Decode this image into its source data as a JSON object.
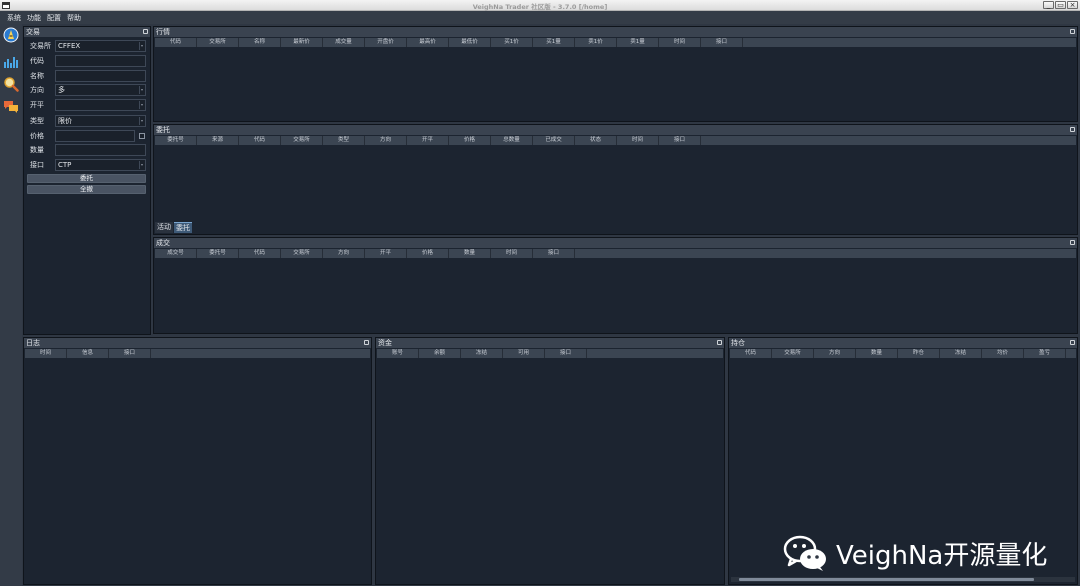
{
  "window": {
    "title": "VeighNa Trader 社区版 - 3.7.0   [/home]",
    "buttons": [
      "_",
      "▭",
      "×"
    ]
  },
  "menu": [
    "系统",
    "功能",
    "配置",
    "帮助"
  ],
  "toolbar": {
    "icons": [
      "logo-icon",
      "chart-icon",
      "search-icon",
      "chat-icon"
    ]
  },
  "trade_panel": {
    "title": "交易",
    "fields": {
      "exchange": {
        "label": "交易所",
        "value": "CFFEX"
      },
      "symbol": {
        "label": "代码",
        "value": ""
      },
      "name": {
        "label": "名称",
        "value": ""
      },
      "direction": {
        "label": "方向",
        "value": "多"
      },
      "offset": {
        "label": "开平",
        "value": ""
      },
      "type": {
        "label": "类型",
        "value": "限价"
      },
      "price": {
        "label": "价格",
        "value": ""
      },
      "volume": {
        "label": "数量",
        "value": ""
      },
      "gateway": {
        "label": "接口",
        "value": "CTP"
      }
    },
    "send_button": "委托",
    "cancel_all_button": "全撤"
  },
  "market_panel": {
    "title": "行情",
    "columns": [
      "代码",
      "交易所",
      "名称",
      "最新价",
      "成交量",
      "开盘价",
      "最高价",
      "最低价",
      "买1价",
      "买1量",
      "卖1价",
      "卖1量",
      "时间",
      "接口"
    ]
  },
  "order_panel": {
    "title": "委托",
    "columns": [
      "委托号",
      "来源",
      "代码",
      "交易所",
      "类型",
      "方向",
      "开平",
      "价格",
      "总数量",
      "已成交",
      "状态",
      "时间",
      "接口"
    ],
    "tabs": [
      {
        "label": "活动",
        "active": false
      },
      {
        "label": "委托",
        "active": true
      }
    ]
  },
  "trade_record_panel": {
    "title": "成交",
    "columns": [
      "成交号",
      "委托号",
      "代码",
      "交易所",
      "方向",
      "开平",
      "价格",
      "数量",
      "时间",
      "接口"
    ]
  },
  "log_panel": {
    "title": "日志",
    "columns": [
      "时间",
      "信息",
      "接口"
    ]
  },
  "account_panel": {
    "title": "资金",
    "columns": [
      "账号",
      "余额",
      "冻结",
      "可用",
      "接口"
    ]
  },
  "position_panel": {
    "title": "持仓",
    "columns": [
      "代码",
      "交易所",
      "方向",
      "数量",
      "昨仓",
      "冻结",
      "均价",
      "盈亏"
    ]
  },
  "watermark": {
    "text": "VeighNa开源量化",
    "icon": "wechat-icon"
  },
  "colors": {
    "background": "#2f3743",
    "panel": "#1c2430",
    "header": "#3b4552",
    "accent": "#3e5a78"
  }
}
